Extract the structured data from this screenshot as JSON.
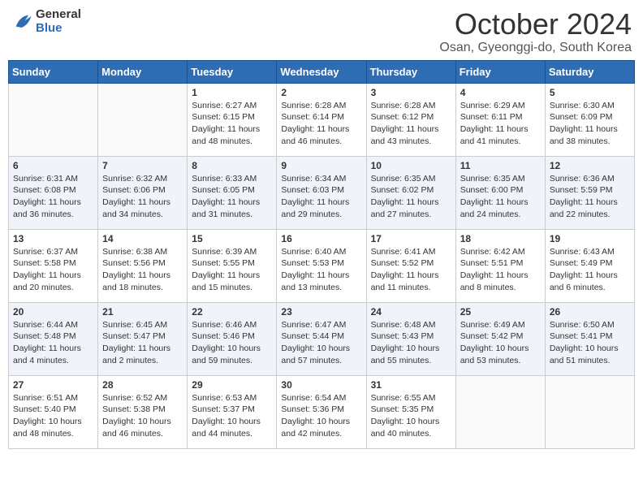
{
  "header": {
    "logo_general": "General",
    "logo_blue": "Blue",
    "month_title": "October 2024",
    "location": "Osan, Gyeonggi-do, South Korea"
  },
  "days_of_week": [
    "Sunday",
    "Monday",
    "Tuesday",
    "Wednesday",
    "Thursday",
    "Friday",
    "Saturday"
  ],
  "weeks": [
    [
      {
        "day": "",
        "content": ""
      },
      {
        "day": "",
        "content": ""
      },
      {
        "day": "1",
        "content": "Sunrise: 6:27 AM\nSunset: 6:15 PM\nDaylight: 11 hours and 48 minutes."
      },
      {
        "day": "2",
        "content": "Sunrise: 6:28 AM\nSunset: 6:14 PM\nDaylight: 11 hours and 46 minutes."
      },
      {
        "day": "3",
        "content": "Sunrise: 6:28 AM\nSunset: 6:12 PM\nDaylight: 11 hours and 43 minutes."
      },
      {
        "day": "4",
        "content": "Sunrise: 6:29 AM\nSunset: 6:11 PM\nDaylight: 11 hours and 41 minutes."
      },
      {
        "day": "5",
        "content": "Sunrise: 6:30 AM\nSunset: 6:09 PM\nDaylight: 11 hours and 38 minutes."
      }
    ],
    [
      {
        "day": "6",
        "content": "Sunrise: 6:31 AM\nSunset: 6:08 PM\nDaylight: 11 hours and 36 minutes."
      },
      {
        "day": "7",
        "content": "Sunrise: 6:32 AM\nSunset: 6:06 PM\nDaylight: 11 hours and 34 minutes."
      },
      {
        "day": "8",
        "content": "Sunrise: 6:33 AM\nSunset: 6:05 PM\nDaylight: 11 hours and 31 minutes."
      },
      {
        "day": "9",
        "content": "Sunrise: 6:34 AM\nSunset: 6:03 PM\nDaylight: 11 hours and 29 minutes."
      },
      {
        "day": "10",
        "content": "Sunrise: 6:35 AM\nSunset: 6:02 PM\nDaylight: 11 hours and 27 minutes."
      },
      {
        "day": "11",
        "content": "Sunrise: 6:35 AM\nSunset: 6:00 PM\nDaylight: 11 hours and 24 minutes."
      },
      {
        "day": "12",
        "content": "Sunrise: 6:36 AM\nSunset: 5:59 PM\nDaylight: 11 hours and 22 minutes."
      }
    ],
    [
      {
        "day": "13",
        "content": "Sunrise: 6:37 AM\nSunset: 5:58 PM\nDaylight: 11 hours and 20 minutes."
      },
      {
        "day": "14",
        "content": "Sunrise: 6:38 AM\nSunset: 5:56 PM\nDaylight: 11 hours and 18 minutes."
      },
      {
        "day": "15",
        "content": "Sunrise: 6:39 AM\nSunset: 5:55 PM\nDaylight: 11 hours and 15 minutes."
      },
      {
        "day": "16",
        "content": "Sunrise: 6:40 AM\nSunset: 5:53 PM\nDaylight: 11 hours and 13 minutes."
      },
      {
        "day": "17",
        "content": "Sunrise: 6:41 AM\nSunset: 5:52 PM\nDaylight: 11 hours and 11 minutes."
      },
      {
        "day": "18",
        "content": "Sunrise: 6:42 AM\nSunset: 5:51 PM\nDaylight: 11 hours and 8 minutes."
      },
      {
        "day": "19",
        "content": "Sunrise: 6:43 AM\nSunset: 5:49 PM\nDaylight: 11 hours and 6 minutes."
      }
    ],
    [
      {
        "day": "20",
        "content": "Sunrise: 6:44 AM\nSunset: 5:48 PM\nDaylight: 11 hours and 4 minutes."
      },
      {
        "day": "21",
        "content": "Sunrise: 6:45 AM\nSunset: 5:47 PM\nDaylight: 11 hours and 2 minutes."
      },
      {
        "day": "22",
        "content": "Sunrise: 6:46 AM\nSunset: 5:46 PM\nDaylight: 10 hours and 59 minutes."
      },
      {
        "day": "23",
        "content": "Sunrise: 6:47 AM\nSunset: 5:44 PM\nDaylight: 10 hours and 57 minutes."
      },
      {
        "day": "24",
        "content": "Sunrise: 6:48 AM\nSunset: 5:43 PM\nDaylight: 10 hours and 55 minutes."
      },
      {
        "day": "25",
        "content": "Sunrise: 6:49 AM\nSunset: 5:42 PM\nDaylight: 10 hours and 53 minutes."
      },
      {
        "day": "26",
        "content": "Sunrise: 6:50 AM\nSunset: 5:41 PM\nDaylight: 10 hours and 51 minutes."
      }
    ],
    [
      {
        "day": "27",
        "content": "Sunrise: 6:51 AM\nSunset: 5:40 PM\nDaylight: 10 hours and 48 minutes."
      },
      {
        "day": "28",
        "content": "Sunrise: 6:52 AM\nSunset: 5:38 PM\nDaylight: 10 hours and 46 minutes."
      },
      {
        "day": "29",
        "content": "Sunrise: 6:53 AM\nSunset: 5:37 PM\nDaylight: 10 hours and 44 minutes."
      },
      {
        "day": "30",
        "content": "Sunrise: 6:54 AM\nSunset: 5:36 PM\nDaylight: 10 hours and 42 minutes."
      },
      {
        "day": "31",
        "content": "Sunrise: 6:55 AM\nSunset: 5:35 PM\nDaylight: 10 hours and 40 minutes."
      },
      {
        "day": "",
        "content": ""
      },
      {
        "day": "",
        "content": ""
      }
    ]
  ]
}
